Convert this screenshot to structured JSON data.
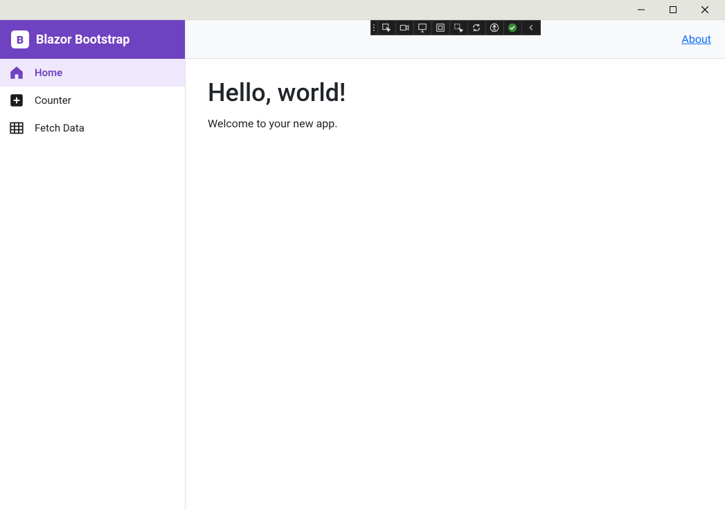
{
  "window": {
    "minimize": "Minimize",
    "maximize": "Maximize",
    "close": "Close"
  },
  "sidebar": {
    "brand": "Blazor Bootstrap",
    "brand_badge": "B",
    "items": [
      {
        "label": "Home",
        "icon": "house-icon",
        "active": true
      },
      {
        "label": "Counter",
        "icon": "plus-square-icon",
        "active": false
      },
      {
        "label": "Fetch Data",
        "icon": "table-icon",
        "active": false
      }
    ]
  },
  "topbar": {
    "about": "About"
  },
  "main": {
    "heading": "Hello, world!",
    "subtext": "Welcome to your new app."
  },
  "colors": {
    "brand": "#6f42c1",
    "active_bg": "#efe7fb",
    "link": "#0d6efd"
  }
}
